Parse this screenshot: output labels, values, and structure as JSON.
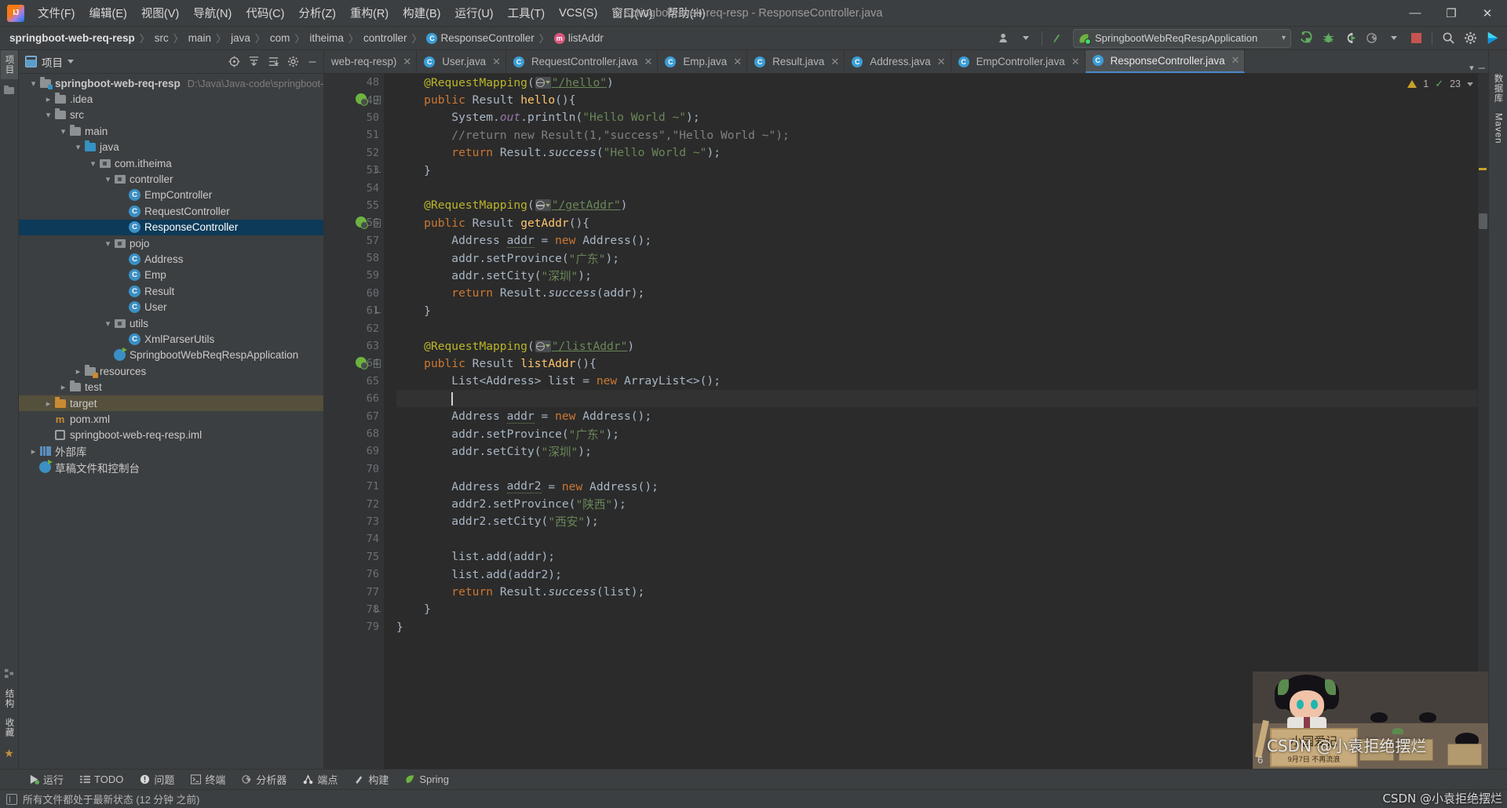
{
  "window": {
    "title": "springboot-web-req-resp - ResponseController.java",
    "controls": {
      "minimize": "—",
      "maximize": "❐",
      "close": "✕"
    }
  },
  "menu": {
    "items": [
      "文件(F)",
      "编辑(E)",
      "视图(V)",
      "导航(N)",
      "代码(C)",
      "分析(Z)",
      "重构(R)",
      "构建(B)",
      "运行(U)",
      "工具(T)",
      "VCS(S)",
      "窗口(W)",
      "帮助(H)"
    ]
  },
  "breadcrumb": {
    "items": [
      {
        "label": "springboot-web-req-resp",
        "icon": "",
        "bold": true
      },
      {
        "label": "src",
        "icon": ""
      },
      {
        "label": "main",
        "icon": ""
      },
      {
        "label": "java",
        "icon": ""
      },
      {
        "label": "com",
        "icon": ""
      },
      {
        "label": "itheima",
        "icon": ""
      },
      {
        "label": "controller",
        "icon": ""
      },
      {
        "label": "ResponseController",
        "icon": "class-icon"
      },
      {
        "label": "listAddr",
        "icon": "method-icon"
      }
    ],
    "separator": "〉"
  },
  "toolbar": {
    "run_config": "SpringbootWebReqRespApplication",
    "run_config_caret": "▾",
    "icons": [
      "user-icon",
      "vcs-update-icon",
      "run-icon",
      "debug-icon",
      "run-coverage-icon",
      "profiler-icon",
      "stop-icon",
      "search-icon",
      "settings-icon",
      "ide-assistant-icon"
    ]
  },
  "project_panel": {
    "title": "项目",
    "tools": [
      "locate-icon",
      "collapse-all-icon",
      "expand-icon",
      "settings-icon",
      "hide-icon"
    ],
    "tree": [
      {
        "depth": 0,
        "arrow": "down",
        "icon": "module-folder",
        "label": "springboot-web-req-resp",
        "path": "D:\\Java\\Java-code\\springboot-",
        "bold": true
      },
      {
        "depth": 1,
        "arrow": "right",
        "icon": "folder",
        "label": ".idea"
      },
      {
        "depth": 1,
        "arrow": "down",
        "icon": "folder",
        "label": "src"
      },
      {
        "depth": 2,
        "arrow": "down",
        "icon": "folder",
        "label": "main"
      },
      {
        "depth": 3,
        "arrow": "down",
        "icon": "folder-blue",
        "label": "java"
      },
      {
        "depth": 4,
        "arrow": "down",
        "icon": "package",
        "label": "com.itheima"
      },
      {
        "depth": 5,
        "arrow": "down",
        "icon": "package",
        "label": "controller"
      },
      {
        "depth": 6,
        "arrow": "none",
        "icon": "class",
        "label": "EmpController"
      },
      {
        "depth": 6,
        "arrow": "none",
        "icon": "class",
        "label": "RequestController"
      },
      {
        "depth": 6,
        "arrow": "none",
        "icon": "class",
        "label": "ResponseController",
        "selected": true
      },
      {
        "depth": 5,
        "arrow": "down",
        "icon": "package",
        "label": "pojo"
      },
      {
        "depth": 6,
        "arrow": "none",
        "icon": "class",
        "label": "Address"
      },
      {
        "depth": 6,
        "arrow": "none",
        "icon": "class",
        "label": "Emp"
      },
      {
        "depth": 6,
        "arrow": "none",
        "icon": "class",
        "label": "Result"
      },
      {
        "depth": 6,
        "arrow": "none",
        "icon": "class",
        "label": "User"
      },
      {
        "depth": 5,
        "arrow": "down",
        "icon": "package",
        "label": "utils"
      },
      {
        "depth": 6,
        "arrow": "none",
        "icon": "class",
        "label": "XmlParserUtils"
      },
      {
        "depth": 5,
        "arrow": "none",
        "icon": "spring-class",
        "label": "SpringbootWebReqRespApplication"
      },
      {
        "depth": 3,
        "arrow": "right",
        "icon": "folder-res",
        "label": "resources"
      },
      {
        "depth": 2,
        "arrow": "right",
        "icon": "folder",
        "label": "test"
      },
      {
        "depth": 1,
        "arrow": "right",
        "icon": "folder-orange",
        "label": "target",
        "highlight": true
      },
      {
        "depth": 1,
        "arrow": "none",
        "icon": "maven",
        "label": "pom.xml"
      },
      {
        "depth": 1,
        "arrow": "none",
        "icon": "iml",
        "label": "springboot-web-req-resp.iml"
      },
      {
        "depth": 0,
        "arrow": "right",
        "icon": "library",
        "label": "外部库"
      },
      {
        "depth": 0,
        "arrow": "none",
        "icon": "scratch",
        "label": "草稿文件和控制台"
      }
    ]
  },
  "editor_tabs": {
    "tabs": [
      {
        "label": "web-req-resp)",
        "icon": "none",
        "active": false,
        "truncated": true
      },
      {
        "label": "User.java",
        "icon": "class",
        "active": false
      },
      {
        "label": "RequestController.java",
        "icon": "class",
        "active": false
      },
      {
        "label": "Emp.java",
        "icon": "class",
        "active": false
      },
      {
        "label": "Result.java",
        "icon": "class",
        "active": false
      },
      {
        "label": "Address.java",
        "icon": "class",
        "active": false
      },
      {
        "label": "EmpController.java",
        "icon": "class",
        "active": false
      },
      {
        "label": "ResponseController.java",
        "icon": "class",
        "active": true
      }
    ],
    "close_glyph": "✕",
    "overflow_glyph": "▾"
  },
  "inspection": {
    "warning_count": "1",
    "ok_count": "23",
    "warning_icon": "warning-triangle-icon",
    "ok_icon": "check-icon",
    "caret": "▾"
  },
  "editor": {
    "first_line_number": 48,
    "current_line": 66,
    "lines": [
      {
        "n": 48,
        "indent": 1,
        "tokens": [
          {
            "t": "anno",
            "v": "@RequestMapping"
          },
          {
            "t": "plain",
            "v": "("
          },
          {
            "t": "webicon",
            "v": ""
          },
          {
            "t": "urlstr",
            "v": "\"/hello\""
          },
          {
            "t": "plain",
            "v": ")"
          }
        ]
      },
      {
        "n": 49,
        "indent": 1,
        "gutter": "run-fold",
        "tokens": [
          {
            "t": "kw",
            "v": "public "
          },
          {
            "t": "plain",
            "v": "Result "
          },
          {
            "t": "mth",
            "v": "hello"
          },
          {
            "t": "plain",
            "v": "(){"
          }
        ]
      },
      {
        "n": 50,
        "indent": 2,
        "tokens": [
          {
            "t": "plain",
            "v": "System."
          },
          {
            "t": "fld",
            "v": "out"
          },
          {
            "t": "plain",
            "v": ".println("
          },
          {
            "t": "str",
            "v": "\"Hello World ~\""
          },
          {
            "t": "plain",
            "v": ");"
          }
        ]
      },
      {
        "n": 51,
        "indent": 2,
        "tokens": [
          {
            "t": "cmt",
            "v": "//return new Result(1,\"success\",\"Hello World ~\");"
          }
        ]
      },
      {
        "n": 52,
        "indent": 2,
        "tokens": [
          {
            "t": "kw",
            "v": "return "
          },
          {
            "t": "plain",
            "v": "Result."
          },
          {
            "t": "stat",
            "v": "success"
          },
          {
            "t": "plain",
            "v": "("
          },
          {
            "t": "str",
            "v": "\"Hello World ~\""
          },
          {
            "t": "plain",
            "v": ");"
          }
        ]
      },
      {
        "n": 53,
        "indent": 1,
        "gutter": "fold-end",
        "tokens": [
          {
            "t": "plain",
            "v": "}"
          }
        ]
      },
      {
        "n": 54,
        "indent": 0,
        "tokens": []
      },
      {
        "n": 55,
        "indent": 1,
        "tokens": [
          {
            "t": "anno",
            "v": "@RequestMapping"
          },
          {
            "t": "plain",
            "v": "("
          },
          {
            "t": "webicon",
            "v": ""
          },
          {
            "t": "urlstr",
            "v": "\"/getAddr\""
          },
          {
            "t": "plain",
            "v": ")"
          }
        ]
      },
      {
        "n": 56,
        "indent": 1,
        "gutter": "run-fold",
        "tokens": [
          {
            "t": "kw",
            "v": "public "
          },
          {
            "t": "plain",
            "v": "Result "
          },
          {
            "t": "mth",
            "v": "getAddr"
          },
          {
            "t": "plain",
            "v": "(){"
          }
        ]
      },
      {
        "n": 57,
        "indent": 2,
        "tokens": [
          {
            "t": "plain",
            "v": "Address "
          },
          {
            "t": "wave",
            "v": "addr"
          },
          {
            "t": "plain",
            "v": " = "
          },
          {
            "t": "kw",
            "v": "new "
          },
          {
            "t": "plain",
            "v": "Address();"
          }
        ]
      },
      {
        "n": 58,
        "indent": 2,
        "tokens": [
          {
            "t": "plain",
            "v": "addr.setProvince("
          },
          {
            "t": "str",
            "v": "\"广东\""
          },
          {
            "t": "plain",
            "v": ");"
          }
        ]
      },
      {
        "n": 59,
        "indent": 2,
        "tokens": [
          {
            "t": "plain",
            "v": "addr.setCity("
          },
          {
            "t": "str",
            "v": "\"深圳\""
          },
          {
            "t": "plain",
            "v": ");"
          }
        ]
      },
      {
        "n": 60,
        "indent": 2,
        "tokens": [
          {
            "t": "kw",
            "v": "return "
          },
          {
            "t": "plain",
            "v": "Result."
          },
          {
            "t": "stat",
            "v": "success"
          },
          {
            "t": "plain",
            "v": "(addr);"
          }
        ]
      },
      {
        "n": 61,
        "indent": 1,
        "gutter": "fold-end",
        "tokens": [
          {
            "t": "plain",
            "v": "}"
          }
        ]
      },
      {
        "n": 62,
        "indent": 0,
        "tokens": []
      },
      {
        "n": 63,
        "indent": 1,
        "tokens": [
          {
            "t": "anno",
            "v": "@RequestMapping"
          },
          {
            "t": "plain",
            "v": "("
          },
          {
            "t": "webicon",
            "v": ""
          },
          {
            "t": "urlstr",
            "v": "\"/listAddr\""
          },
          {
            "t": "plain",
            "v": ")"
          }
        ]
      },
      {
        "n": 64,
        "indent": 1,
        "gutter": "run-fold",
        "tokens": [
          {
            "t": "kw",
            "v": "public "
          },
          {
            "t": "plain",
            "v": "Result "
          },
          {
            "t": "mth",
            "v": "listAddr"
          },
          {
            "t": "plain",
            "v": "(){"
          }
        ]
      },
      {
        "n": 65,
        "indent": 2,
        "tokens": [
          {
            "t": "plain",
            "v": "List<Address> list = "
          },
          {
            "t": "kw",
            "v": "new "
          },
          {
            "t": "plain",
            "v": "ArrayList<>();"
          }
        ]
      },
      {
        "n": 66,
        "indent": 2,
        "current": true,
        "tokens": [
          {
            "t": "caret",
            "v": ""
          }
        ]
      },
      {
        "n": 67,
        "indent": 2,
        "tokens": [
          {
            "t": "plain",
            "v": "Address "
          },
          {
            "t": "wave",
            "v": "addr"
          },
          {
            "t": "plain",
            "v": " = "
          },
          {
            "t": "kw",
            "v": "new "
          },
          {
            "t": "plain",
            "v": "Address();"
          }
        ]
      },
      {
        "n": 68,
        "indent": 2,
        "tokens": [
          {
            "t": "plain",
            "v": "addr.setProvince("
          },
          {
            "t": "str",
            "v": "\"广东\""
          },
          {
            "t": "plain",
            "v": ");"
          }
        ]
      },
      {
        "n": 69,
        "indent": 2,
        "tokens": [
          {
            "t": "plain",
            "v": "addr.setCity("
          },
          {
            "t": "str",
            "v": "\"深圳\""
          },
          {
            "t": "plain",
            "v": ");"
          }
        ]
      },
      {
        "n": 70,
        "indent": 0,
        "tokens": []
      },
      {
        "n": 71,
        "indent": 2,
        "tokens": [
          {
            "t": "plain",
            "v": "Address "
          },
          {
            "t": "wave",
            "v": "addr2"
          },
          {
            "t": "plain",
            "v": " = "
          },
          {
            "t": "kw",
            "v": "new "
          },
          {
            "t": "plain",
            "v": "Address();"
          }
        ]
      },
      {
        "n": 72,
        "indent": 2,
        "tokens": [
          {
            "t": "plain",
            "v": "addr2.setProvince("
          },
          {
            "t": "str",
            "v": "\"陕西\""
          },
          {
            "t": "plain",
            "v": ");"
          }
        ]
      },
      {
        "n": 73,
        "indent": 2,
        "tokens": [
          {
            "t": "plain",
            "v": "addr2.setCity("
          },
          {
            "t": "str",
            "v": "\"西安\""
          },
          {
            "t": "plain",
            "v": ");"
          }
        ]
      },
      {
        "n": 74,
        "indent": 0,
        "tokens": []
      },
      {
        "n": 75,
        "indent": 2,
        "tokens": [
          {
            "t": "plain",
            "v": "list.add(addr);"
          }
        ]
      },
      {
        "n": 76,
        "indent": 2,
        "tokens": [
          {
            "t": "plain",
            "v": "list.add(addr2);"
          }
        ]
      },
      {
        "n": 77,
        "indent": 2,
        "tokens": [
          {
            "t": "kw",
            "v": "return "
          },
          {
            "t": "plain",
            "v": "Result."
          },
          {
            "t": "stat",
            "v": "success"
          },
          {
            "t": "plain",
            "v": "(list);"
          }
        ]
      },
      {
        "n": 78,
        "indent": 1,
        "gutter": "fold-end",
        "tokens": [
          {
            "t": "plain",
            "v": "}"
          }
        ]
      },
      {
        "n": 79,
        "indent": 0,
        "tokens": [
          {
            "t": "plain",
            "v": "}"
          }
        ]
      }
    ]
  },
  "left_rail": {
    "tabs": [
      "项目"
    ],
    "bottom_tabs": [
      "结构",
      "收藏"
    ]
  },
  "right_rail": {
    "tabs": [
      "数据库",
      "Maven"
    ]
  },
  "bottom_toolbar": {
    "buttons": [
      {
        "label": "运行",
        "icon": "run-icon"
      },
      {
        "label": "TODO",
        "icon": "todo-icon"
      },
      {
        "label": "问题",
        "icon": "problems-icon"
      },
      {
        "label": "终端",
        "icon": "terminal-icon"
      },
      {
        "label": "分析器",
        "icon": "profiler-icon"
      },
      {
        "label": "端点",
        "icon": "endpoints-icon"
      },
      {
        "label": "构建",
        "icon": "build-icon"
      },
      {
        "label": "Spring",
        "icon": "spring-icon"
      }
    ]
  },
  "status_bar": {
    "icon": "vcs-status-icon",
    "message": "所有文件都处于最新状态 (12 分钟 之前)"
  },
  "watermark": {
    "csdn": "CSDN @小袁拒绝摆烂",
    "sign_title": "小园爱记",
    "sign_sub": "9月7日  不再流浪",
    "counter": "6"
  },
  "colors": {
    "bg_chrome": "#3c3f41",
    "bg_editor": "#2b2b2b",
    "accent_blue": "#4a88c7",
    "select_blue": "#0d3a58",
    "keyword_orange": "#cc7832",
    "string_green": "#6a8759",
    "anno_yellow": "#bbb529",
    "method_gold": "#ffc66d",
    "field_purple": "#9876aa",
    "comment_gray": "#808080",
    "spring_green": "#6db33f"
  }
}
